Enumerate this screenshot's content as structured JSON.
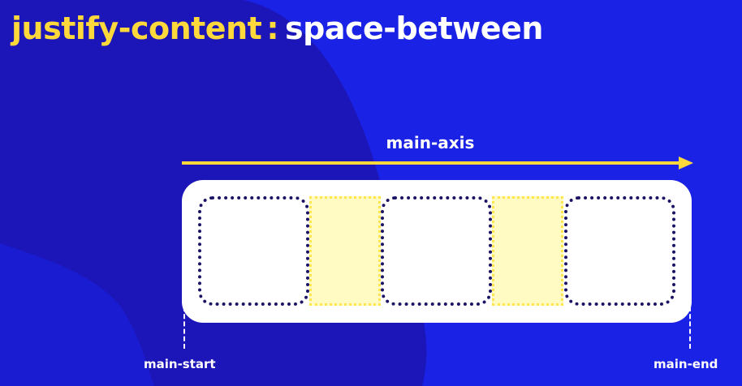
{
  "title": {
    "property": "justify-content",
    "separator": ":",
    "value": "space-between"
  },
  "diagram": {
    "axis_label": "main-axis",
    "start_label": "main-start",
    "end_label": "main-end",
    "item_count": 3,
    "gap_count": 2
  },
  "colors": {
    "background": "#1A22E6",
    "background_shape": "#1C16B8",
    "accent_yellow": "#FFD93B",
    "item_border": "#1B1464",
    "gap_fill": "#FFFBC2",
    "gap_border": "#FFE64D",
    "container": "#FFFFFF"
  }
}
